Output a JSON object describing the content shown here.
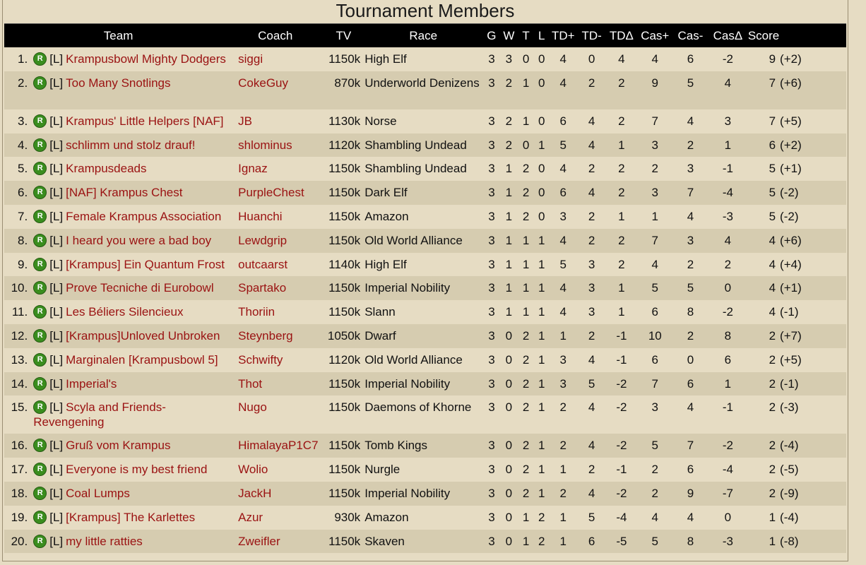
{
  "title": "Tournament Members",
  "headers": [
    "Team",
    "Coach",
    "TV",
    "Race",
    "G",
    "W",
    "T",
    "L",
    "TD+",
    "TD-",
    "TDΔ",
    "Cas+",
    "Cas-",
    "CasΔ",
    "Score"
  ],
  "badge_letter": "R",
  "league_tag": "[L]",
  "rows": [
    {
      "rank": "1.",
      "team": "Krampusbowl Mighty Dodgers",
      "coach": "siggi",
      "tv": "1150k",
      "race": "High Elf",
      "g": "3",
      "w": "3",
      "t": "0",
      "l": "0",
      "tdp": "4",
      "tdm": "0",
      "tdd": "4",
      "casp": "4",
      "casm": "6",
      "casd": "-2",
      "score": "9",
      "bonus": "(+2)"
    },
    {
      "rank": "2.",
      "team": "Too Many Snotlings",
      "coach": "CokeGuy",
      "tv": "870k",
      "race": "Underworld Denizens",
      "g": "3",
      "w": "2",
      "t": "1",
      "l": "0",
      "tdp": "4",
      "tdm": "2",
      "tdd": "2",
      "casp": "9",
      "casm": "5",
      "casd": "4",
      "score": "7",
      "bonus": "(+6)"
    },
    {
      "rank": "3.",
      "team": "Krampus' Little Helpers [NAF]",
      "coach": "JB",
      "tv": "1130k",
      "race": "Norse",
      "g": "3",
      "w": "2",
      "t": "1",
      "l": "0",
      "tdp": "6",
      "tdm": "4",
      "tdd": "2",
      "casp": "7",
      "casm": "4",
      "casd": "3",
      "score": "7",
      "bonus": "(+5)"
    },
    {
      "rank": "4.",
      "team": "schlimm und stolz drauf!",
      "coach": "shlominus",
      "tv": "1120k",
      "race": "Shambling Undead",
      "g": "3",
      "w": "2",
      "t": "0",
      "l": "1",
      "tdp": "5",
      "tdm": "4",
      "tdd": "1",
      "casp": "3",
      "casm": "2",
      "casd": "1",
      "score": "6",
      "bonus": "(+2)"
    },
    {
      "rank": "5.",
      "team": "Krampusdeads",
      "coach": "Ignaz",
      "tv": "1150k",
      "race": "Shambling Undead",
      "g": "3",
      "w": "1",
      "t": "2",
      "l": "0",
      "tdp": "4",
      "tdm": "2",
      "tdd": "2",
      "casp": "2",
      "casm": "3",
      "casd": "-1",
      "score": "5",
      "bonus": "(+1)"
    },
    {
      "rank": "6.",
      "team": "[NAF] Krampus Chest",
      "coach": "PurpleChest",
      "tv": "1150k",
      "race": "Dark Elf",
      "g": "3",
      "w": "1",
      "t": "2",
      "l": "0",
      "tdp": "6",
      "tdm": "4",
      "tdd": "2",
      "casp": "3",
      "casm": "7",
      "casd": "-4",
      "score": "5",
      "bonus": "(-2)"
    },
    {
      "rank": "7.",
      "team": "Female Krampus Association",
      "coach": "Huanchi",
      "tv": "1150k",
      "race": "Amazon",
      "g": "3",
      "w": "1",
      "t": "2",
      "l": "0",
      "tdp": "3",
      "tdm": "2",
      "tdd": "1",
      "casp": "1",
      "casm": "4",
      "casd": "-3",
      "score": "5",
      "bonus": "(-2)"
    },
    {
      "rank": "8.",
      "team": "I heard you were a bad boy",
      "coach": "Lewdgrip",
      "tv": "1150k",
      "race": "Old World Alliance",
      "g": "3",
      "w": "1",
      "t": "1",
      "l": "1",
      "tdp": "4",
      "tdm": "2",
      "tdd": "2",
      "casp": "7",
      "casm": "3",
      "casd": "4",
      "score": "4",
      "bonus": "(+6)"
    },
    {
      "rank": "9.",
      "team": "[Krampus] Ein Quantum Frost",
      "coach": "outcaarst",
      "tv": "1140k",
      "race": "High Elf",
      "g": "3",
      "w": "1",
      "t": "1",
      "l": "1",
      "tdp": "5",
      "tdm": "3",
      "tdd": "2",
      "casp": "4",
      "casm": "2",
      "casd": "2",
      "score": "4",
      "bonus": "(+4)"
    },
    {
      "rank": "10.",
      "team": "Prove Tecniche di Eurobowl",
      "coach": "Spartako",
      "tv": "1150k",
      "race": "Imperial Nobility",
      "g": "3",
      "w": "1",
      "t": "1",
      "l": "1",
      "tdp": "4",
      "tdm": "3",
      "tdd": "1",
      "casp": "5",
      "casm": "5",
      "casd": "0",
      "score": "4",
      "bonus": "(+1)"
    },
    {
      "rank": "11.",
      "team": "Les Béliers Silencieux",
      "coach": "Thoriin",
      "tv": "1150k",
      "race": "Slann",
      "g": "3",
      "w": "1",
      "t": "1",
      "l": "1",
      "tdp": "4",
      "tdm": "3",
      "tdd": "1",
      "casp": "6",
      "casm": "8",
      "casd": "-2",
      "score": "4",
      "bonus": "(-1)"
    },
    {
      "rank": "12.",
      "team": "[Krampus]Unloved Unbroken",
      "coach": "Steynberg",
      "tv": "1050k",
      "race": "Dwarf",
      "g": "3",
      "w": "0",
      "t": "2",
      "l": "1",
      "tdp": "1",
      "tdm": "2",
      "tdd": "-1",
      "casp": "10",
      "casm": "2",
      "casd": "8",
      "score": "2",
      "bonus": "(+7)"
    },
    {
      "rank": "13.",
      "team": "Marginalen [Krampusbowl 5]",
      "coach": "Schwifty",
      "tv": "1120k",
      "race": "Old World Alliance",
      "g": "3",
      "w": "0",
      "t": "2",
      "l": "1",
      "tdp": "3",
      "tdm": "4",
      "tdd": "-1",
      "casp": "6",
      "casm": "0",
      "casd": "6",
      "score": "2",
      "bonus": "(+5)"
    },
    {
      "rank": "14.",
      "team": "Imperial's",
      "coach": "Thot",
      "tv": "1150k",
      "race": "Imperial Nobility",
      "g": "3",
      "w": "0",
      "t": "2",
      "l": "1",
      "tdp": "3",
      "tdm": "5",
      "tdd": "-2",
      "casp": "7",
      "casm": "6",
      "casd": "1",
      "score": "2",
      "bonus": "(-1)"
    },
    {
      "rank": "15.",
      "team": "Scyla and Friends-Revengening",
      "coach": "Nugo",
      "tv": "1150k",
      "race": "Daemons of Khorne",
      "g": "3",
      "w": "0",
      "t": "2",
      "l": "1",
      "tdp": "2",
      "tdm": "4",
      "tdd": "-2",
      "casp": "3",
      "casm": "4",
      "casd": "-1",
      "score": "2",
      "bonus": "(-3)"
    },
    {
      "rank": "16.",
      "team": "Gruß vom Krampus",
      "coach": "HimalayaP1C7",
      "tv": "1150k",
      "race": "Tomb Kings",
      "g": "3",
      "w": "0",
      "t": "2",
      "l": "1",
      "tdp": "2",
      "tdm": "4",
      "tdd": "-2",
      "casp": "5",
      "casm": "7",
      "casd": "-2",
      "score": "2",
      "bonus": "(-4)"
    },
    {
      "rank": "17.",
      "team": "Everyone is my best friend",
      "coach": "Wolio",
      "tv": "1150k",
      "race": "Nurgle",
      "g": "3",
      "w": "0",
      "t": "2",
      "l": "1",
      "tdp": "1",
      "tdm": "2",
      "tdd": "-1",
      "casp": "2",
      "casm": "6",
      "casd": "-4",
      "score": "2",
      "bonus": "(-5)"
    },
    {
      "rank": "18.",
      "team": "Coal Lumps",
      "coach": "JackH",
      "tv": "1150k",
      "race": "Imperial Nobility",
      "g": "3",
      "w": "0",
      "t": "2",
      "l": "1",
      "tdp": "2",
      "tdm": "4",
      "tdd": "-2",
      "casp": "2",
      "casm": "9",
      "casd": "-7",
      "score": "2",
      "bonus": "(-9)"
    },
    {
      "rank": "19.",
      "team": "[Krampus] The Karlettes",
      "coach": "Azur",
      "tv": "930k",
      "race": "Amazon",
      "g": "3",
      "w": "0",
      "t": "1",
      "l": "2",
      "tdp": "1",
      "tdm": "5",
      "tdd": "-4",
      "casp": "4",
      "casm": "4",
      "casd": "0",
      "score": "1",
      "bonus": "(-4)"
    },
    {
      "rank": "20.",
      "team": "my little ratties",
      "coach": "Zweifler",
      "tv": "1150k",
      "race": "Skaven",
      "g": "3",
      "w": "0",
      "t": "1",
      "l": "2",
      "tdp": "1",
      "tdm": "6",
      "tdd": "-5",
      "casp": "5",
      "casm": "8",
      "casd": "-3",
      "score": "1",
      "bonus": "(-8)"
    }
  ]
}
